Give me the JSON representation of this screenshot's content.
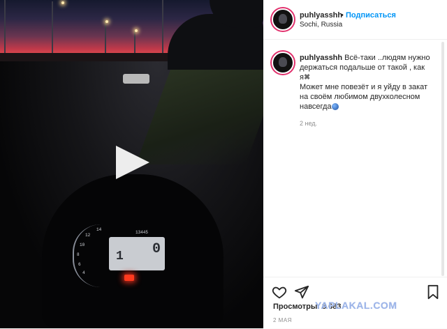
{
  "post": {
    "username": "puhlyasshh",
    "separator": "•",
    "follow_label": "Подписаться",
    "location": "Sochi, Russia",
    "caption": {
      "user": "puhlyasshh",
      "line1": " Всё-таки ..людям нужно",
      "line2": "держаться подальше от такой , как",
      "line3": "я",
      "line4": "Может мне повезёт и я уйду в закат",
      "line5": "на своём любимом двухколесном",
      "line6": "навсегда"
    },
    "time_ago": "2 нед.",
    "views_label": "Просмотры: 8 683",
    "date": "2 МАЯ"
  },
  "video": {
    "dash_odometer": "13445",
    "dash_gear": "0",
    "dash_speed": "1"
  },
  "watermark": "YAPLAKAL.COM",
  "icons": {
    "play": "play-icon",
    "like": "heart-icon",
    "share": "paper-plane-icon",
    "save": "bookmark-icon"
  },
  "colors": {
    "follow": "#0095f6",
    "story_ring": "#e1306c"
  }
}
